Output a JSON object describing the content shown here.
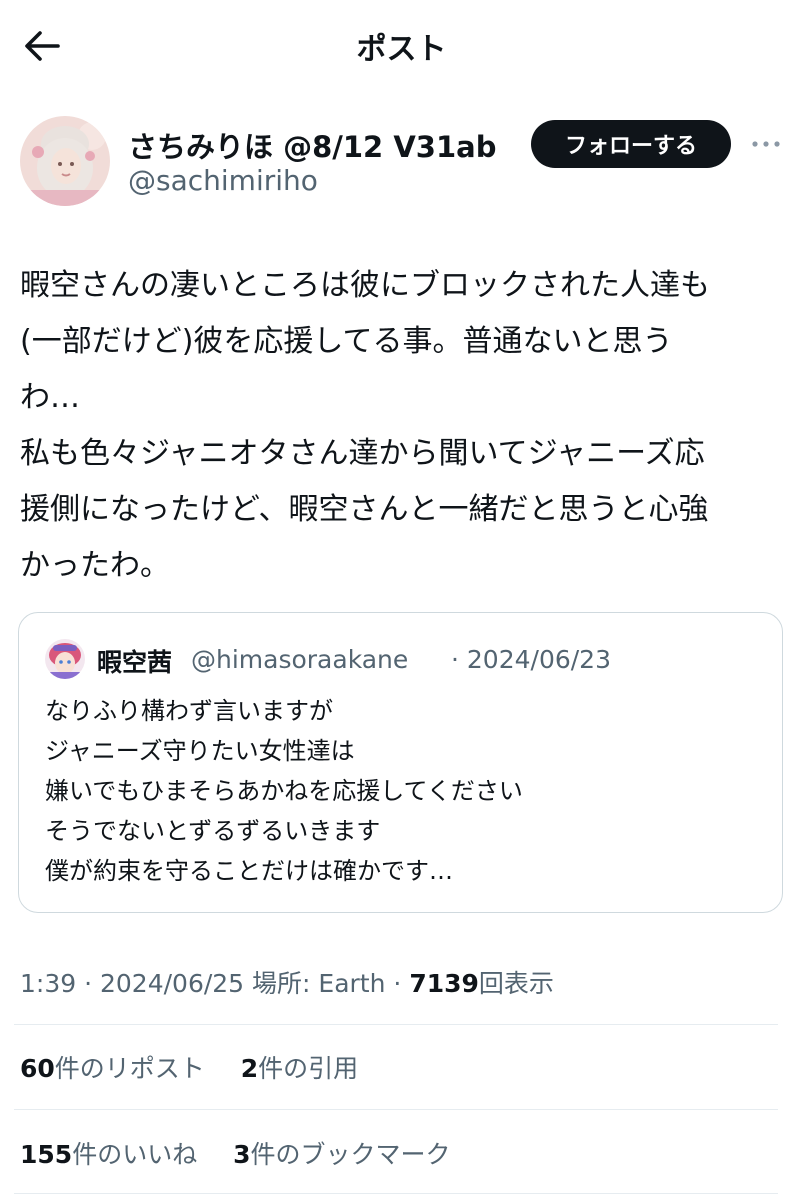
{
  "header": {
    "title": "ポスト",
    "back_icon": "back-arrow-icon"
  },
  "author": {
    "display_name": "さちみりほ @8/12 V31ab",
    "handle": "@sachimiriho",
    "follow_label": "フォローする",
    "more_icon": "more-horizontal-icon"
  },
  "post": {
    "lines": [
      "暇空さんの凄いところは彼にブロックされた人達も",
      "(一部だけど)彼を応援してる事。普通ないと思う",
      "わ…",
      "私も色々ジャニオタさん達から聞いてジャニーズ応",
      "援側になったけど、暇空さんと一緒だと思うと心強",
      "かったわ。"
    ]
  },
  "quote": {
    "name": "暇空茜",
    "handle": "@himasoraakane",
    "date": "· 2024/06/23",
    "lines": [
      "なりふり構わず言いますが",
      "ジャニーズ守りたい女性達は",
      "嫌いでもひまそらあかねを応援してください",
      "そうでないとずるずるいきます",
      "僕が約束を守ることだけは確かです…"
    ]
  },
  "meta": {
    "time": "1:39",
    "date": "· 2024/06/25",
    "location": "場所: Earth ·",
    "views_count": "7139",
    "views_label": "回表示"
  },
  "stats": {
    "reposts_count": "60",
    "reposts_label": "件のリポスト",
    "quotes_count": "2",
    "quotes_label": "件の引用",
    "likes_count": "155",
    "likes_label": "件のいいね",
    "bookmarks_count": "3",
    "bookmarks_label": "件のブックマーク"
  },
  "colors": {
    "text": "#0f1419",
    "secondary": "#536471",
    "border": "#cfd9de",
    "button_bg": "#0f1419"
  }
}
